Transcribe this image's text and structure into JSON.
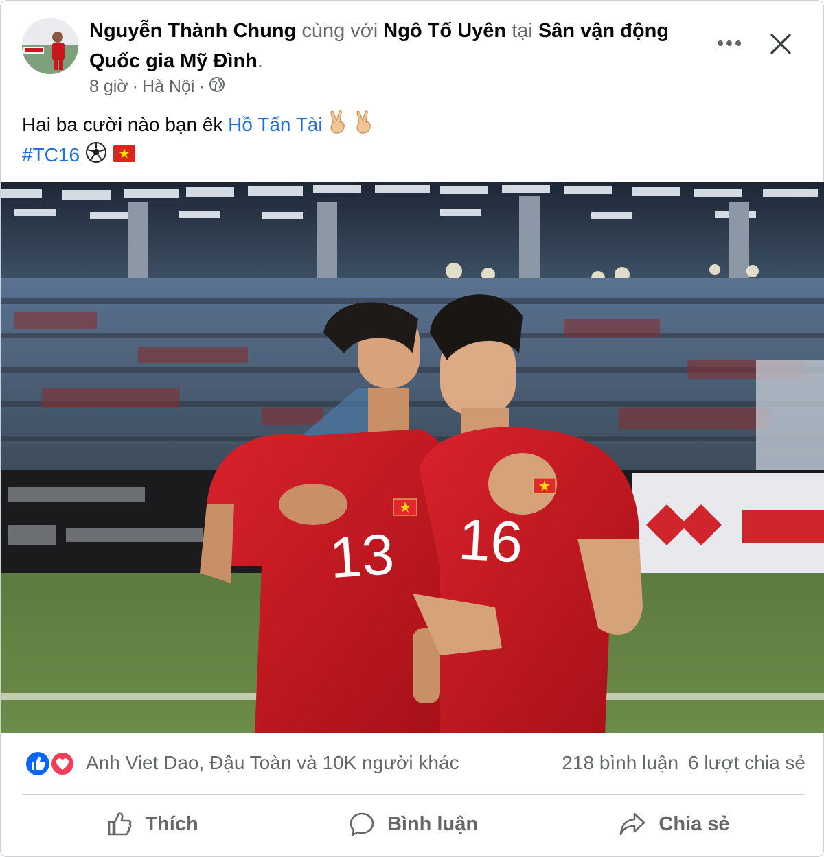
{
  "post": {
    "author": "Nguyễn Thành Chung",
    "with_word": "cùng với",
    "tagged": "Ngô Tố Uyên",
    "at_word": "tại",
    "place": "Sân vận động Quốc gia Mỹ Đình",
    "period": ".",
    "time": "8 giờ",
    "separator": "·",
    "location": "Hà Nội",
    "privacy_icon": "globe-icon",
    "text_line1": "Hai ba cười nào bạn êk",
    "mention": "Hồ Tấn Tài",
    "emoji_line1": "victory-hand-emoji x2",
    "hashtag": "#TC16",
    "emoji_line2": "soccer-ball-emoji, vietnam-flag-emoji",
    "photo_numbers": [
      "13",
      "16"
    ]
  },
  "reactions": {
    "icons": [
      "like-icon",
      "love-icon"
    ],
    "names": "Anh Viet Dao, Đậu Toàn và 10K người khác",
    "comments": "218 bình luận",
    "shares": "6 lượt chia sẻ"
  },
  "actions": {
    "like": "Thích",
    "comment": "Bình luận",
    "share": "Chia sẻ"
  },
  "colors": {
    "link": "#216fdb",
    "secondary_text": "#65676b",
    "like_blue": "#0866ff",
    "love_red": "#f33e58",
    "jersey_red": "#c8161d"
  }
}
